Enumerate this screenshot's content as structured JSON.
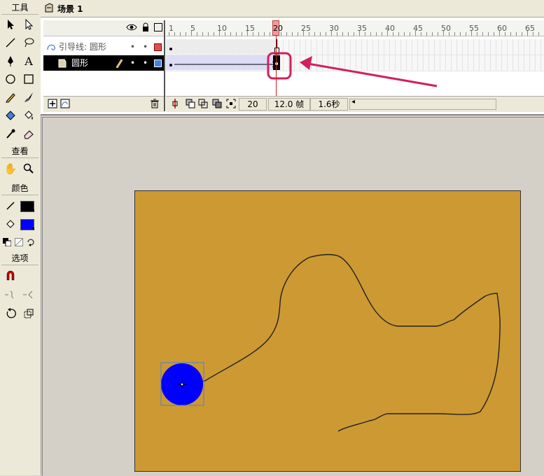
{
  "scene": {
    "title": "场景 1"
  },
  "tools": {
    "sections": {
      "tools": "工具",
      "view": "查看",
      "colors": "颜色",
      "options": "选项"
    },
    "icons": [
      "arrow-icon",
      "subselect-icon",
      "line-icon",
      "lasso-icon",
      "pen-icon",
      "text-icon",
      "oval-icon",
      "rectangle-icon",
      "pencil-icon",
      "brush-icon",
      "ink-bottle-icon",
      "paint-bucket-icon",
      "eyedropper-icon",
      "eraser-icon",
      "hand-icon",
      "zoom-icon"
    ],
    "stroke_color": "#000000",
    "fill_color": "#0000ff"
  },
  "timeline": {
    "ruler_labels": [
      "1",
      "5",
      "10",
      "15",
      "20",
      "25",
      "30",
      "35",
      "40",
      "45",
      "50",
      "55",
      "60",
      "65"
    ],
    "playhead_frame": "20",
    "layers": [
      {
        "name": "引导线: 圆形",
        "color": "#e05050"
      },
      {
        "name": "圆形",
        "color": "#4a7fd8"
      }
    ],
    "status": {
      "frame": "20",
      "fps": "12.0 帧",
      "time": "1.6秒"
    }
  },
  "stage": {
    "background": "#cc9933",
    "circle_color": "#0000ff"
  },
  "annotation": {
    "highlight_color": "#d02060"
  }
}
